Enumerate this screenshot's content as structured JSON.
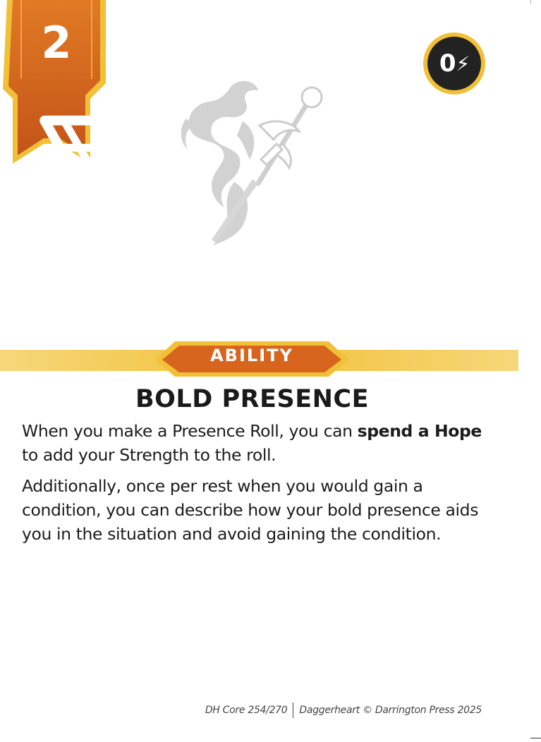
{
  "card": {
    "level": "2",
    "recall_cost": "0",
    "type": "ABILITY",
    "title": "BOLD PRESENCE",
    "body": {
      "p1_before": "When you make a Presence Roll, you can ",
      "p1_bold": "spend a Hope",
      "p1_after": " to add your Strength to the roll.",
      "p2": "Additionally, once per rest when you would gain a condition, you can describe how your bold presence aids you in the situation and avoid gaining the condition."
    },
    "footer": {
      "set_code": "DH Core 254/270",
      "copyright": "Daggerheart © Darrington Press 2025"
    }
  },
  "icons": {
    "domain": "valor-domain-icon",
    "cost": "bolt-icon",
    "art": "dragon-sword-icon"
  },
  "colors": {
    "banner_orange": "#d4641c",
    "banner_gold": "#f2c037",
    "ribbon_gold": "#f4c94a",
    "text_dark": "#1a1a1a",
    "coin_dark": "#222222",
    "art_gray": "#cfcfcf"
  }
}
